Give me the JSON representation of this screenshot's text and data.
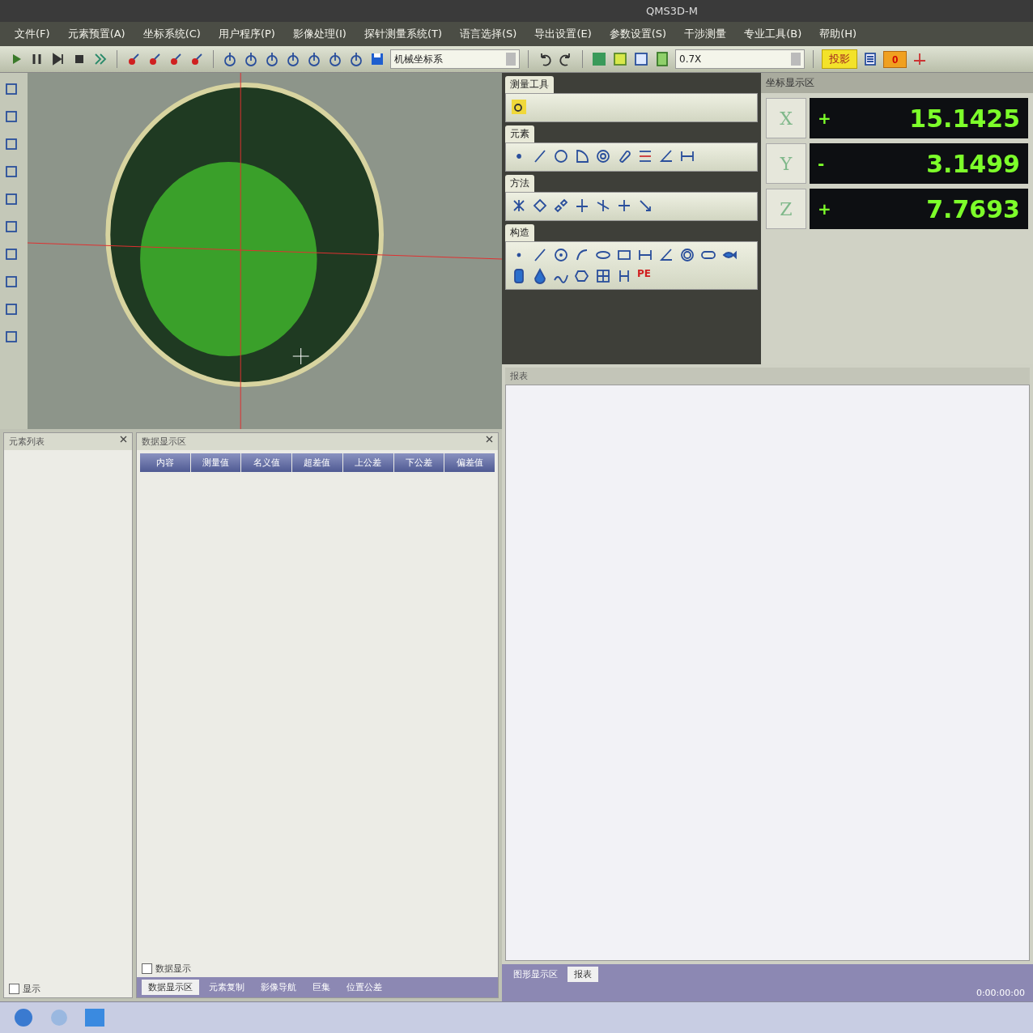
{
  "window": {
    "title": "QMS3D-M"
  },
  "menu": [
    "文件(F)",
    "元素预置(A)",
    "坐标系统(C)",
    "用户程序(P)",
    "影像处理(I)",
    "探针测量系统(T)",
    "语言选择(S)",
    "导出设置(E)",
    "参数设置(S)",
    "干涉测量",
    "专业工具(B)",
    "帮助(H)"
  ],
  "toolbar": {
    "coordinate_system": "机械坐标系",
    "zoom": "0.7X",
    "projection_button": "投影",
    "counter": "0"
  },
  "tool_panels": [
    {
      "title": "测量工具"
    },
    {
      "title": "元素"
    },
    {
      "title": "方法"
    },
    {
      "title": "构造",
      "mark": "PE"
    }
  ],
  "coordinates": {
    "title": "坐标显示区",
    "axes": [
      {
        "axis": "X",
        "sign": "+",
        "value": "15.1425"
      },
      {
        "axis": "Y",
        "sign": "-",
        "value": "3.1499"
      },
      {
        "axis": "Z",
        "sign": "+",
        "value": "7.7693"
      }
    ]
  },
  "report_panel": {
    "title": "报表"
  },
  "element_list": {
    "title": "元素列表",
    "checkbox": {
      "label": "显示",
      "checked": false
    }
  },
  "data_panel": {
    "title": "数据显示区",
    "columns": [
      "内容",
      "测量值",
      "名义值",
      "超差值",
      "上公差",
      "下公差",
      "偏差值"
    ],
    "checkbox": {
      "label": "数据显示",
      "checked": false
    }
  },
  "bottom_tabs": [
    {
      "label": "数据显示区",
      "selected": true
    },
    {
      "label": "元素复制",
      "selected": false
    },
    {
      "label": "影像导航",
      "selected": false
    },
    {
      "label": "巨集",
      "selected": false
    },
    {
      "label": "位置公差",
      "selected": false
    }
  ],
  "right_tabs": [
    {
      "label": "图形显示区",
      "selected": false
    },
    {
      "label": "报表",
      "selected": true
    }
  ],
  "status_bar": {
    "time": "0:00:00:00"
  }
}
